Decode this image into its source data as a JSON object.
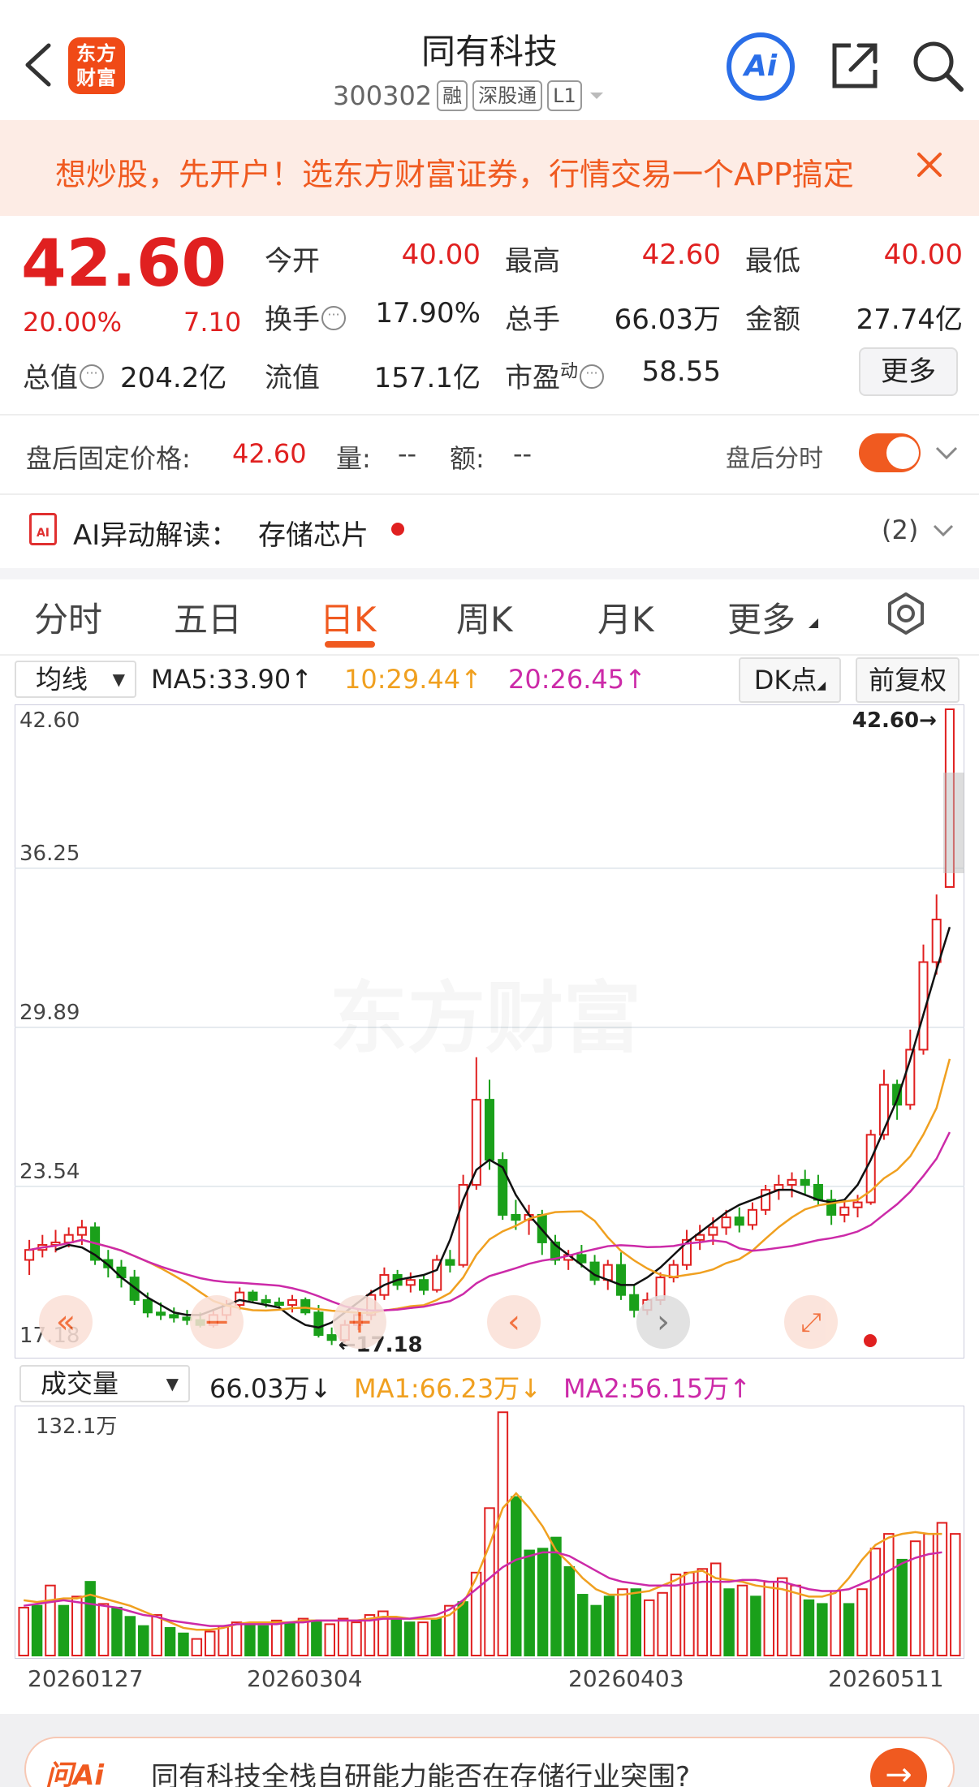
{
  "header": {
    "logo_text": "东方\n财富",
    "title": "同有科技",
    "code": "300302",
    "tags": [
      "融",
      "深股通",
      "L1"
    ],
    "ai_label": "Ai"
  },
  "banner": {
    "text": "想炒股，先开户！选东方财富证券，行情交易一个APP搞定"
  },
  "quote": {
    "price": "42.60",
    "change_pct": "20.00%",
    "change": "7.10",
    "stats": [
      {
        "label": "今开",
        "value": "40.00",
        "color": "red"
      },
      {
        "label": "最高",
        "value": "42.60",
        "color": "red"
      },
      {
        "label": "最低",
        "value": "40.00",
        "color": "red"
      },
      {
        "label": "换手",
        "value": "17.90%",
        "color": "black"
      },
      {
        "label": "总手",
        "value": "66.03万",
        "color": "black"
      },
      {
        "label": "金额",
        "value": "27.74亿",
        "color": "black"
      },
      {
        "label": "总值",
        "value": "204.2亿",
        "color": "black"
      },
      {
        "label": "流值",
        "value": "157.1亿",
        "color": "black"
      },
      {
        "label": "市盈",
        "label_sup": "动",
        "value": "58.55",
        "color": "black"
      }
    ],
    "more_label": "更多"
  },
  "after_hours": {
    "label": "盘后固定价格:",
    "price": "42.60",
    "vol_label": "量:",
    "vol_value": "--",
    "amt_label": "额:",
    "amt_value": "--",
    "timeshare_label": "盘后分时",
    "toggle_on": true
  },
  "ai_reading": {
    "label": "AI异动解读：",
    "topic": "存储芯片",
    "count": "(2)"
  },
  "tabs": [
    "分时",
    "五日",
    "日K",
    "周K",
    "月K",
    "更多"
  ],
  "active_tab": "日K",
  "ma_row": {
    "select": "均线",
    "ma5": "MA5:33.90",
    "ma10": "10:29.44",
    "ma20": "20:26.45",
    "dk_label": "DK点",
    "adjust_label": "前复权"
  },
  "volume_row": {
    "select": "成交量",
    "vol": "66.03万",
    "ma1": "MA1:66.23万",
    "ma2": "MA2:56.15万"
  },
  "bottom": {
    "question": "同有科技全栈自研能力能否在存储行业突围?"
  },
  "colors": {
    "up": "#e02020",
    "down": "#1aa01a",
    "ma5": "#111111",
    "ma10": "#f0a020",
    "ma20": "#cc2aa8",
    "accent": "#f05a20"
  },
  "chart_data": [
    {
      "type": "candlestick",
      "y_ticks": [
        "42.60",
        "36.25",
        "29.89",
        "23.54",
        "17.18"
      ],
      "ylim": [
        17.18,
        42.6
      ],
      "max_label": "42.60",
      "min_label": "17.18",
      "watermark": "东方财富",
      "x_ticks": [
        "20260127",
        "20260304",
        "20260403",
        "20260511"
      ],
      "candles": [
        [
          20.6,
          21.4,
          20.0,
          21.0
        ],
        [
          21.0,
          21.6,
          20.7,
          21.2
        ],
        [
          21.2,
          21.8,
          20.9,
          21.3
        ],
        [
          21.3,
          21.9,
          21.1,
          21.6
        ],
        [
          21.6,
          22.2,
          21.2,
          21.9
        ],
        [
          21.9,
          22.1,
          20.4,
          20.6
        ],
        [
          20.6,
          21.0,
          19.9,
          20.3
        ],
        [
          20.3,
          20.6,
          19.5,
          19.9
        ],
        [
          19.9,
          20.2,
          18.8,
          19.0
        ],
        [
          19.0,
          19.3,
          18.3,
          18.5
        ],
        [
          18.5,
          18.9,
          18.2,
          18.4
        ],
        [
          18.4,
          18.7,
          18.1,
          18.3
        ],
        [
          18.3,
          18.6,
          18.0,
          18.2
        ],
        [
          18.2,
          18.5,
          17.9,
          18.0
        ],
        [
          18.0,
          18.6,
          17.9,
          18.4
        ],
        [
          18.4,
          19.0,
          18.2,
          18.8
        ],
        [
          18.8,
          19.5,
          18.6,
          19.3
        ],
        [
          19.3,
          19.4,
          18.9,
          19.0
        ],
        [
          19.0,
          19.2,
          18.7,
          18.9
        ],
        [
          18.9,
          19.1,
          18.7,
          18.8
        ],
        [
          18.8,
          19.2,
          18.5,
          19.0
        ],
        [
          19.0,
          19.1,
          18.4,
          18.5
        ],
        [
          18.5,
          18.8,
          17.5,
          17.6
        ],
        [
          17.6,
          17.9,
          17.2,
          17.4
        ],
        [
          17.4,
          18.2,
          17.3,
          18.0
        ],
        [
          18.0,
          18.6,
          17.8,
          18.4
        ],
        [
          18.4,
          19.4,
          18.2,
          19.2
        ],
        [
          19.2,
          20.3,
          19.0,
          20.0
        ],
        [
          20.0,
          20.2,
          19.4,
          19.6
        ],
        [
          19.6,
          20.1,
          19.3,
          19.8
        ],
        [
          19.8,
          20.0,
          19.2,
          19.4
        ],
        [
          19.4,
          20.8,
          19.3,
          20.6
        ],
        [
          20.6,
          21.0,
          20.1,
          20.4
        ],
        [
          20.4,
          24.0,
          20.3,
          23.6
        ],
        [
          23.6,
          28.7,
          23.4,
          27.0
        ],
        [
          27.0,
          27.8,
          24.2,
          24.6
        ],
        [
          24.6,
          24.9,
          22.2,
          22.4
        ],
        [
          22.4,
          23.0,
          21.8,
          22.2
        ],
        [
          22.2,
          22.8,
          21.6,
          22.4
        ],
        [
          22.4,
          22.6,
          20.8,
          21.3
        ],
        [
          21.3,
          21.6,
          20.4,
          20.6
        ],
        [
          20.6,
          21.0,
          20.2,
          20.8
        ],
        [
          20.8,
          21.2,
          20.3,
          20.5
        ],
        [
          20.5,
          20.8,
          19.6,
          19.8
        ],
        [
          19.8,
          20.6,
          19.4,
          20.4
        ],
        [
          20.4,
          20.9,
          19.0,
          19.2
        ],
        [
          19.2,
          19.6,
          18.3,
          18.6
        ],
        [
          18.6,
          19.3,
          18.4,
          19.0
        ],
        [
          19.0,
          20.1,
          18.8,
          19.9
        ],
        [
          19.9,
          20.6,
          19.7,
          20.4
        ],
        [
          20.4,
          21.8,
          20.2,
          21.4
        ],
        [
          21.4,
          22.0,
          21.0,
          21.6
        ],
        [
          21.6,
          22.3,
          21.2,
          21.9
        ],
        [
          21.9,
          22.6,
          21.6,
          22.3
        ],
        [
          22.3,
          22.7,
          21.7,
          22.0
        ],
        [
          22.0,
          22.9,
          21.8,
          22.6
        ],
        [
          22.6,
          23.6,
          22.4,
          23.4
        ],
        [
          23.4,
          24.0,
          23.0,
          23.6
        ],
        [
          23.6,
          24.1,
          23.1,
          23.8
        ],
        [
          23.8,
          24.2,
          23.2,
          23.6
        ],
        [
          23.6,
          24.0,
          22.8,
          23.0
        ],
        [
          23.0,
          23.4,
          22.0,
          22.4
        ],
        [
          22.4,
          23.0,
          22.1,
          22.7
        ],
        [
          22.7,
          23.2,
          22.3,
          22.9
        ],
        [
          22.9,
          25.8,
          22.8,
          25.6
        ],
        [
          25.6,
          28.2,
          25.4,
          27.6
        ],
        [
          27.6,
          27.8,
          26.2,
          26.8
        ],
        [
          26.8,
          29.8,
          26.6,
          29.0
        ],
        [
          29.0,
          33.2,
          28.8,
          32.5
        ],
        [
          32.5,
          35.2,
          32.0,
          34.2
        ],
        [
          35.5,
          42.6,
          35.5,
          42.6
        ]
      ],
      "ma5": [
        21.0,
        21.2,
        21.1,
        20.8,
        20.4,
        19.9,
        19.5,
        19.1,
        18.8,
        18.5,
        18.4,
        18.4,
        18.6,
        18.8,
        19.0,
        18.9,
        18.8,
        18.7,
        18.3,
        18.0,
        17.9,
        18.1,
        18.5,
        18.9,
        19.3,
        19.6,
        19.8,
        19.9,
        20.0,
        20.2,
        21.4,
        23.0,
        24.2,
        24.6,
        24.3,
        23.2,
        22.4,
        21.8,
        21.2,
        20.8,
        20.4,
        20.0,
        19.8,
        19.6,
        19.6,
        19.9,
        20.3,
        20.8,
        21.3,
        21.7,
        22.1,
        22.5,
        22.8,
        23.0,
        23.2,
        23.4,
        23.4,
        23.2,
        23.0,
        22.9,
        23.0,
        23.6,
        24.6,
        25.8,
        27.0,
        28.6,
        30.4,
        32.2,
        33.9
      ]
    },
    {
      "type": "bar",
      "name": "volume",
      "unit": "万",
      "y_max_label": "132.1万",
      "y_max": 132.1,
      "values": [
        {
          "v": 26,
          "up": true
        },
        {
          "v": 27,
          "up": false
        },
        {
          "v": 38,
          "up": true
        },
        {
          "v": 27,
          "up": false
        },
        {
          "v": 32,
          "up": true
        },
        {
          "v": 40,
          "up": false
        },
        {
          "v": 28,
          "up": true
        },
        {
          "v": 26,
          "up": false
        },
        {
          "v": 21,
          "up": false
        },
        {
          "v": 16,
          "up": false
        },
        {
          "v": 22,
          "up": true
        },
        {
          "v": 15,
          "up": false
        },
        {
          "v": 12,
          "up": false
        },
        {
          "v": 9,
          "up": true
        },
        {
          "v": 13,
          "up": true
        },
        {
          "v": 16,
          "up": true
        },
        {
          "v": 18,
          "up": true
        },
        {
          "v": 17,
          "up": false
        },
        {
          "v": 16,
          "up": false
        },
        {
          "v": 19,
          "up": true
        },
        {
          "v": 18,
          "up": false
        },
        {
          "v": 20,
          "up": true
        },
        {
          "v": 19,
          "up": false
        },
        {
          "v": 17,
          "up": true
        },
        {
          "v": 20,
          "up": true
        },
        {
          "v": 18,
          "up": true
        },
        {
          "v": 22,
          "up": true
        },
        {
          "v": 24,
          "up": true
        },
        {
          "v": 20,
          "up": false
        },
        {
          "v": 18,
          "up": false
        },
        {
          "v": 18,
          "up": true
        },
        {
          "v": 20,
          "up": false
        },
        {
          "v": 27,
          "up": true
        },
        {
          "v": 29,
          "up": false
        },
        {
          "v": 45,
          "up": true
        },
        {
          "v": 80,
          "up": true
        },
        {
          "v": 132,
          "up": true
        },
        {
          "v": 86,
          "up": false
        },
        {
          "v": 57,
          "up": false
        },
        {
          "v": 58,
          "up": false
        },
        {
          "v": 64,
          "up": false
        },
        {
          "v": 48,
          "up": false
        },
        {
          "v": 33,
          "up": false
        },
        {
          "v": 27,
          "up": false
        },
        {
          "v": 32,
          "up": false
        },
        {
          "v": 36,
          "up": true
        },
        {
          "v": 36,
          "up": false
        },
        {
          "v": 30,
          "up": true
        },
        {
          "v": 34,
          "up": true
        },
        {
          "v": 44,
          "up": true
        },
        {
          "v": 45,
          "up": true
        },
        {
          "v": 47,
          "up": true
        },
        {
          "v": 50,
          "up": true
        },
        {
          "v": 36,
          "up": false
        },
        {
          "v": 38,
          "up": true
        },
        {
          "v": 32,
          "up": false
        },
        {
          "v": 40,
          "up": true
        },
        {
          "v": 42,
          "up": true
        },
        {
          "v": 38,
          "up": true
        },
        {
          "v": 30,
          "up": false
        },
        {
          "v": 28,
          "up": false
        },
        {
          "v": 35,
          "up": true
        },
        {
          "v": 28,
          "up": false
        },
        {
          "v": 36,
          "up": true
        },
        {
          "v": 58,
          "up": true
        },
        {
          "v": 66,
          "up": true
        },
        {
          "v": 52,
          "up": false
        },
        {
          "v": 62,
          "up": true
        },
        {
          "v": 66,
          "up": true
        },
        {
          "v": 72,
          "up": true
        },
        {
          "v": 66,
          "up": true
        }
      ],
      "ma1": [
        30,
        29,
        30,
        31,
        31,
        33,
        31,
        29,
        27,
        24,
        21,
        18,
        15,
        14,
        14,
        15,
        17,
        18,
        18,
        18,
        18,
        19,
        19,
        19,
        19,
        19,
        20,
        21,
        21,
        20,
        20,
        20,
        22,
        28,
        42,
        60,
        80,
        88,
        80,
        70,
        57,
        50,
        42,
        36,
        33,
        33,
        34,
        35,
        38,
        41,
        45,
        46,
        42,
        41,
        40,
        38,
        37,
        36,
        34,
        32,
        32,
        34,
        42,
        52,
        60,
        64,
        66,
        67,
        66,
        66
      ],
      "ma2": [
        27,
        28,
        29,
        30,
        29,
        28,
        27,
        26,
        24,
        22,
        21,
        19,
        18,
        17,
        16,
        16,
        17,
        17,
        17,
        17,
        18,
        18,
        19,
        19,
        19,
        19,
        19,
        20,
        20,
        20,
        21,
        22,
        25,
        30,
        36,
        42,
        48,
        52,
        54,
        56,
        56,
        54,
        50,
        46,
        42,
        40,
        39,
        38,
        38,
        38,
        39,
        40,
        40,
        40,
        41,
        41,
        40,
        40,
        38,
        36,
        35,
        35,
        36,
        39,
        42,
        46,
        50,
        53,
        55,
        56
      ]
    }
  ]
}
